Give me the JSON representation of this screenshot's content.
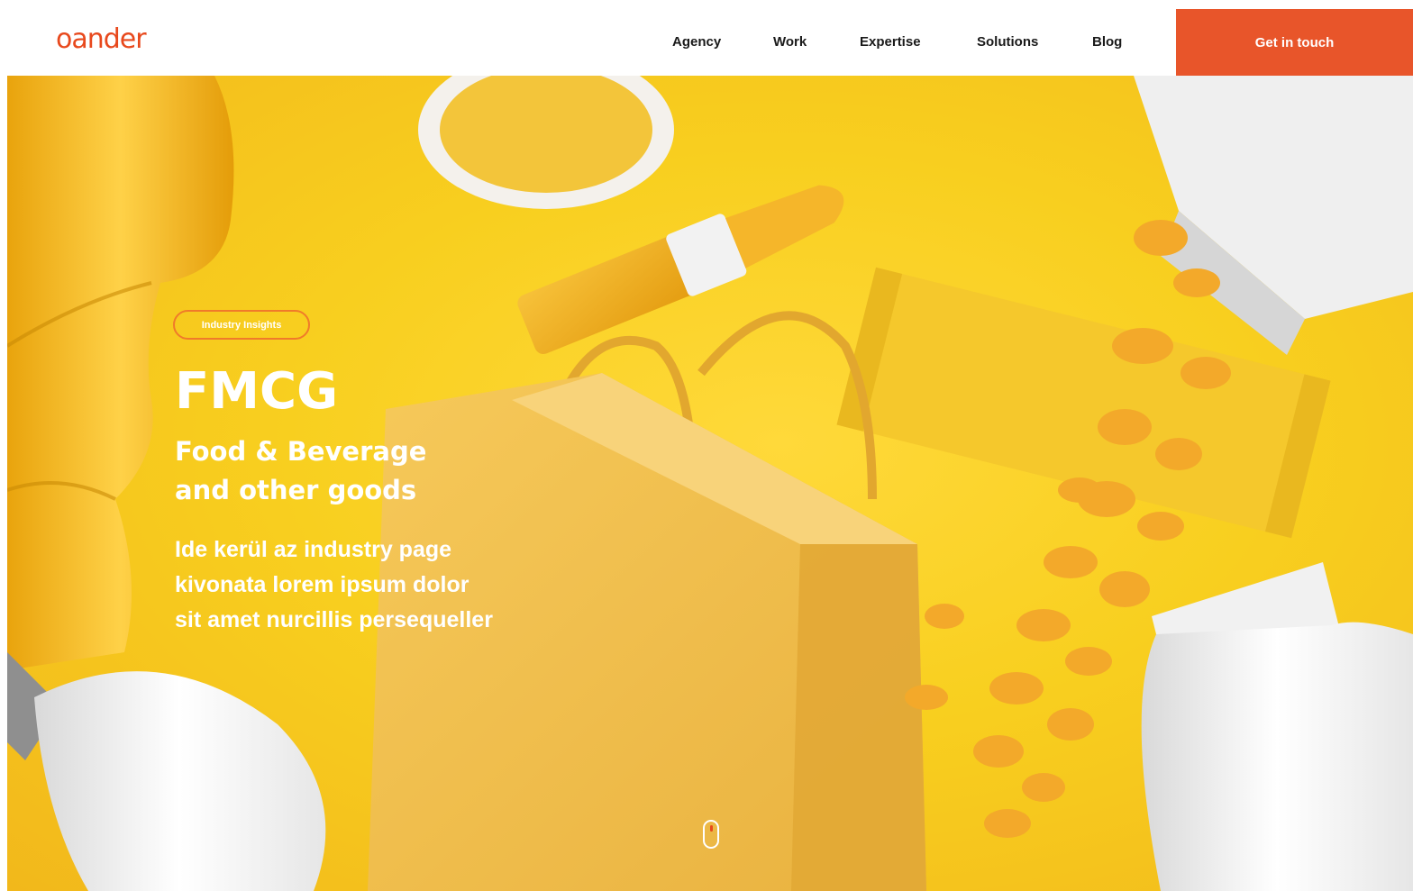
{
  "brand": {
    "logo_text": "oander",
    "accent_color": "#e8491d"
  },
  "nav": {
    "items": [
      {
        "label": "Agency"
      },
      {
        "label": "Work"
      },
      {
        "label": "Expertise"
      },
      {
        "label": "Solutions"
      },
      {
        "label": "Blog"
      }
    ],
    "cta_label": "Get in touch",
    "cta_color": "#e8552a"
  },
  "hero": {
    "badge": "Industry Insights",
    "title": "FMCG",
    "subtitle_line1": "Food & Beverage",
    "subtitle_line2": "and other goods",
    "desc_line1": "Ide kerül az industry page",
    "desc_line2": "kivonata lorem ipsum dolor",
    "desc_line3": "sit amet nurcillis persequeller",
    "background_color": "#f8cf1f",
    "scroll_icon": "mouse-scroll-icon"
  }
}
